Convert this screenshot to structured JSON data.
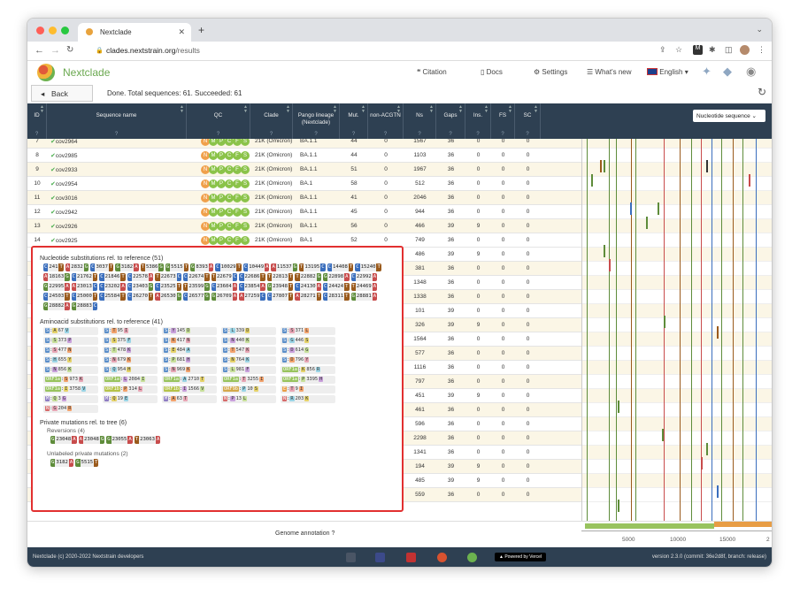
{
  "browser": {
    "tab_title": "Nextclade",
    "url_domain": "clades.nextstrain.org",
    "url_path": "/results"
  },
  "app": {
    "brand": "Nextclade",
    "links": [
      {
        "key": "citation",
        "label": "Citation",
        "icon": "quote-icon"
      },
      {
        "key": "docs",
        "label": "Docs",
        "icon": "book-icon"
      },
      {
        "key": "settings",
        "label": "Settings",
        "icon": "gear-icon"
      },
      {
        "key": "whatsnew",
        "label": "What's new",
        "icon": "list-icon"
      }
    ],
    "language": "English",
    "language_flag": "uk-flag-icon"
  },
  "toolbar": {
    "back_label": "Back",
    "status": "Done. Total sequences: 61. Succeeded: 61"
  },
  "table": {
    "columns": [
      "ID",
      "Sequence name",
      "QC",
      "Clade",
      "Pango lineage (Nextclade)",
      "Mut.",
      "non-ACGTN",
      "Ns",
      "Gaps",
      "Ins.",
      "FS",
      "SC"
    ],
    "help_mark": "?",
    "rows": [
      [
        "7",
        "cov2964",
        "21K (Omicron)",
        "BA.1.1",
        "44",
        "0",
        "1567",
        "36",
        "0",
        "0",
        "0"
      ],
      [
        "8",
        "cov2985",
        "21K (Omicron)",
        "BA.1.1",
        "44",
        "0",
        "1103",
        "36",
        "0",
        "0",
        "0"
      ],
      [
        "9",
        "cov2933",
        "21K (Omicron)",
        "BA.1.1",
        "51",
        "0",
        "1967",
        "36",
        "0",
        "0",
        "0"
      ],
      [
        "10",
        "cov2954",
        "21K (Omicron)",
        "BA.1",
        "58",
        "0",
        "512",
        "36",
        "0",
        "0",
        "0"
      ],
      [
        "11",
        "cov3016",
        "21K (Omicron)",
        "BA.1.1",
        "41",
        "0",
        "2046",
        "36",
        "0",
        "0",
        "0"
      ],
      [
        "12",
        "cov2942",
        "21K (Omicron)",
        "BA.1.1",
        "45",
        "0",
        "944",
        "36",
        "0",
        "0",
        "0"
      ],
      [
        "13",
        "cov2926",
        "21K (Omicron)",
        "BA.1.1",
        "56",
        "0",
        "466",
        "39",
        "9",
        "0",
        "0"
      ],
      [
        "14",
        "cov2925",
        "21K (Omicron)",
        "BA.1",
        "52",
        "0",
        "749",
        "36",
        "0",
        "0",
        "0"
      ]
    ],
    "hidden_rows": [
      [
        "0",
        "486",
        "39",
        "9",
        "0",
        "0"
      ],
      [
        "0",
        "381",
        "36",
        "0",
        "0",
        "0"
      ],
      [
        "0",
        "1348",
        "36",
        "0",
        "0",
        "0"
      ],
      [
        "0",
        "1338",
        "36",
        "0",
        "0",
        "0"
      ],
      [
        "0",
        "101",
        "39",
        "0",
        "0",
        "0"
      ],
      [
        "0",
        "326",
        "39",
        "9",
        "0",
        "0"
      ],
      [
        "0",
        "1564",
        "36",
        "0",
        "0",
        "0"
      ],
      [
        "0",
        "577",
        "36",
        "0",
        "0",
        "0"
      ],
      [
        "0",
        "1116",
        "36",
        "0",
        "0",
        "0"
      ],
      [
        "0",
        "797",
        "36",
        "0",
        "0",
        "0"
      ],
      [
        "0",
        "451",
        "39",
        "9",
        "0",
        "0"
      ],
      [
        "0",
        "461",
        "36",
        "0",
        "0",
        "0"
      ],
      [
        "0",
        "596",
        "36",
        "0",
        "0",
        "0"
      ],
      [
        "0",
        "2298",
        "36",
        "0",
        "0",
        "0"
      ],
      [
        "0",
        "1341",
        "36",
        "0",
        "0",
        "0"
      ],
      [
        "0",
        "194",
        "39",
        "9",
        "0",
        "0"
      ],
      [
        "0",
        "485",
        "39",
        "9",
        "0",
        "0"
      ],
      [
        "0",
        "559",
        "36",
        "0",
        "0",
        "0"
      ]
    ],
    "qc_letters": [
      "N",
      "M",
      "P",
      "C",
      "F",
      "S"
    ],
    "view_select": "Nucleotide sequence"
  },
  "popup": {
    "nuc_title": "Nucleotide substitutions rel. to reference (51)",
    "nuc": [
      [
        "C",
        "241",
        "T"
      ],
      [
        "A",
        "2832",
        "G"
      ],
      [
        "C",
        "3037",
        "T"
      ],
      [
        "G",
        "3182",
        "A"
      ],
      [
        "T",
        "5386",
        "G"
      ],
      [
        "G",
        "5515",
        "T"
      ],
      [
        "G",
        "8393",
        "A"
      ],
      [
        "C",
        "10029",
        "T"
      ],
      [
        "C",
        "10449",
        "A"
      ],
      [
        "A",
        "11537",
        "G"
      ],
      [
        "T",
        "13195",
        "C"
      ],
      [
        "C",
        "14408",
        "T"
      ],
      [
        "C",
        "15240",
        "T"
      ],
      [
        "A",
        "18163",
        "G"
      ],
      [
        "C",
        "21762",
        "T"
      ],
      [
        "C",
        "21846",
        "T"
      ],
      [
        "C",
        "22578",
        "A"
      ],
      [
        "T",
        "22673",
        "C"
      ],
      [
        "C",
        "22674",
        "T"
      ],
      [
        "T",
        "22679",
        "C"
      ],
      [
        "C",
        "22686",
        "T"
      ],
      [
        "T",
        "22813",
        "T"
      ],
      [
        "T",
        "22882",
        "G"
      ],
      [
        "G",
        "22898",
        "A"
      ],
      [
        "C",
        "22992",
        "A"
      ],
      [
        "G",
        "22995",
        "A"
      ],
      [
        "A",
        "23013",
        "C"
      ],
      [
        "C",
        "23202",
        "A"
      ],
      [
        "C",
        "23403",
        "G"
      ],
      [
        "C",
        "23525",
        "T"
      ],
      [
        "T",
        "23599",
        "G"
      ],
      [
        "C",
        "23604",
        "A"
      ],
      [
        "C",
        "23854",
        "A"
      ],
      [
        "G",
        "23948",
        "T"
      ],
      [
        "C",
        "24130",
        "A"
      ],
      [
        "C",
        "24424",
        "T"
      ],
      [
        "T",
        "24469",
        "A"
      ],
      [
        "C",
        "24503",
        "T"
      ],
      [
        "C",
        "25000",
        "T"
      ],
      [
        "C",
        "25584",
        "T"
      ],
      [
        "C",
        "26270",
        "T"
      ],
      [
        "A",
        "26530",
        "G"
      ],
      [
        "C",
        "26577",
        "G"
      ],
      [
        "G",
        "26709",
        "A"
      ],
      [
        "A",
        "27259",
        "C"
      ],
      [
        "C",
        "27807",
        "T"
      ],
      [
        "A",
        "28271",
        "T"
      ],
      [
        "C",
        "28311",
        "T"
      ],
      [
        "G",
        "28881",
        "A"
      ],
      [
        "G",
        "28882",
        "A"
      ],
      [
        "G",
        "28883",
        "C"
      ]
    ],
    "aa_title": "Aminoacid substitutions rel. to reference (41)",
    "aa": [
      [
        "S",
        "A",
        "67",
        "V"
      ],
      [
        "S",
        "T",
        "95",
        "I"
      ],
      [
        "S",
        "Y",
        "145",
        "D"
      ],
      [
        "S",
        "L",
        "339",
        "D"
      ],
      [
        "S",
        "S",
        "371",
        "L"
      ],
      [
        "S",
        "S",
        "373",
        "P"
      ],
      [
        "S",
        "S",
        "375",
        "F"
      ],
      [
        "S",
        "K",
        "417",
        "N"
      ],
      [
        "S",
        "N",
        "440",
        "K"
      ],
      [
        "S",
        "G",
        "446",
        "S"
      ],
      [
        "S",
        "S",
        "477",
        "N"
      ],
      [
        "S",
        "T",
        "478",
        "K"
      ],
      [
        "S",
        "E",
        "484",
        "A"
      ],
      [
        "S",
        "T",
        "547",
        "K"
      ],
      [
        "S",
        "D",
        "614",
        "G"
      ],
      [
        "S",
        "H",
        "655",
        "Y"
      ],
      [
        "S",
        "N",
        "679",
        "K"
      ],
      [
        "S",
        "P",
        "681",
        "H"
      ],
      [
        "S",
        "N",
        "764",
        "K"
      ],
      [
        "S",
        "D",
        "796",
        "Y"
      ],
      [
        "S",
        "N",
        "856",
        "K"
      ],
      [
        "S",
        "Q",
        "954",
        "H"
      ],
      [
        "S",
        "N",
        "969",
        "K"
      ],
      [
        "S",
        "L",
        "981",
        "F"
      ],
      [
        "ORF1a",
        "K",
        "856",
        "R"
      ],
      [
        "ORF1a",
        "S",
        "973",
        "K"
      ],
      [
        "ORF1a",
        "L",
        "2084",
        "I"
      ],
      [
        "ORF1a",
        "A",
        "2710",
        "T"
      ],
      [
        "ORF1a",
        "T",
        "3255",
        "I"
      ],
      [
        "ORF1a",
        "P",
        "3395",
        "H"
      ],
      [
        "ORF1a",
        "I",
        "3758",
        "V"
      ],
      [
        "ORF1b",
        "P",
        "314",
        "L"
      ],
      [
        "ORF1b",
        "I",
        "1566",
        "V"
      ],
      [
        "ORF9b",
        "P",
        "10",
        "S"
      ],
      [
        "E",
        "T",
        "9",
        "I"
      ],
      [
        "M",
        "Q",
        "3",
        "G"
      ],
      [
        "M",
        "Q",
        "19",
        "E"
      ],
      [
        "M",
        "A",
        "63",
        "T"
      ],
      [
        "N",
        "P",
        "13",
        "L"
      ],
      [
        "N",
        "R",
        "203",
        "K"
      ],
      [
        "N",
        "G",
        "204",
        "R"
      ]
    ],
    "priv_title": "Private mutations rel. to tree (6)",
    "rev_title": "Reversions (4)",
    "rev": [
      [
        "G",
        "23048",
        "A"
      ],
      [
        "A",
        "23048",
        "G"
      ],
      [
        "G",
        "23055",
        "A"
      ],
      [
        "T",
        "23063",
        "A"
      ]
    ],
    "unl_title": "Unlabeled private mutations (2)",
    "unl": [
      [
        "G",
        "3182",
        "A"
      ],
      [
        "G",
        "5515",
        "T"
      ]
    ]
  },
  "bottom": {
    "genome_annotation": "Genome annotation",
    "axis_ticks": [
      "5000",
      "10000",
      "15000",
      "2"
    ]
  },
  "footer": {
    "copyright": "Nextclade (c) 2020-2022 Nextstrain developers",
    "powered": "Powered by Vercel",
    "version": "version 2.3.0 (commit: 36e2d8f, branch: release)"
  },
  "colors": {
    "A": "#c84c4c",
    "C": "#3a6ebd",
    "G": "#5e8c3a",
    "T": "#9a5a1c",
    "header": "#2e4052",
    "qc_good": "#8bc34a",
    "qc_mediocre": "#f0a04b"
  }
}
